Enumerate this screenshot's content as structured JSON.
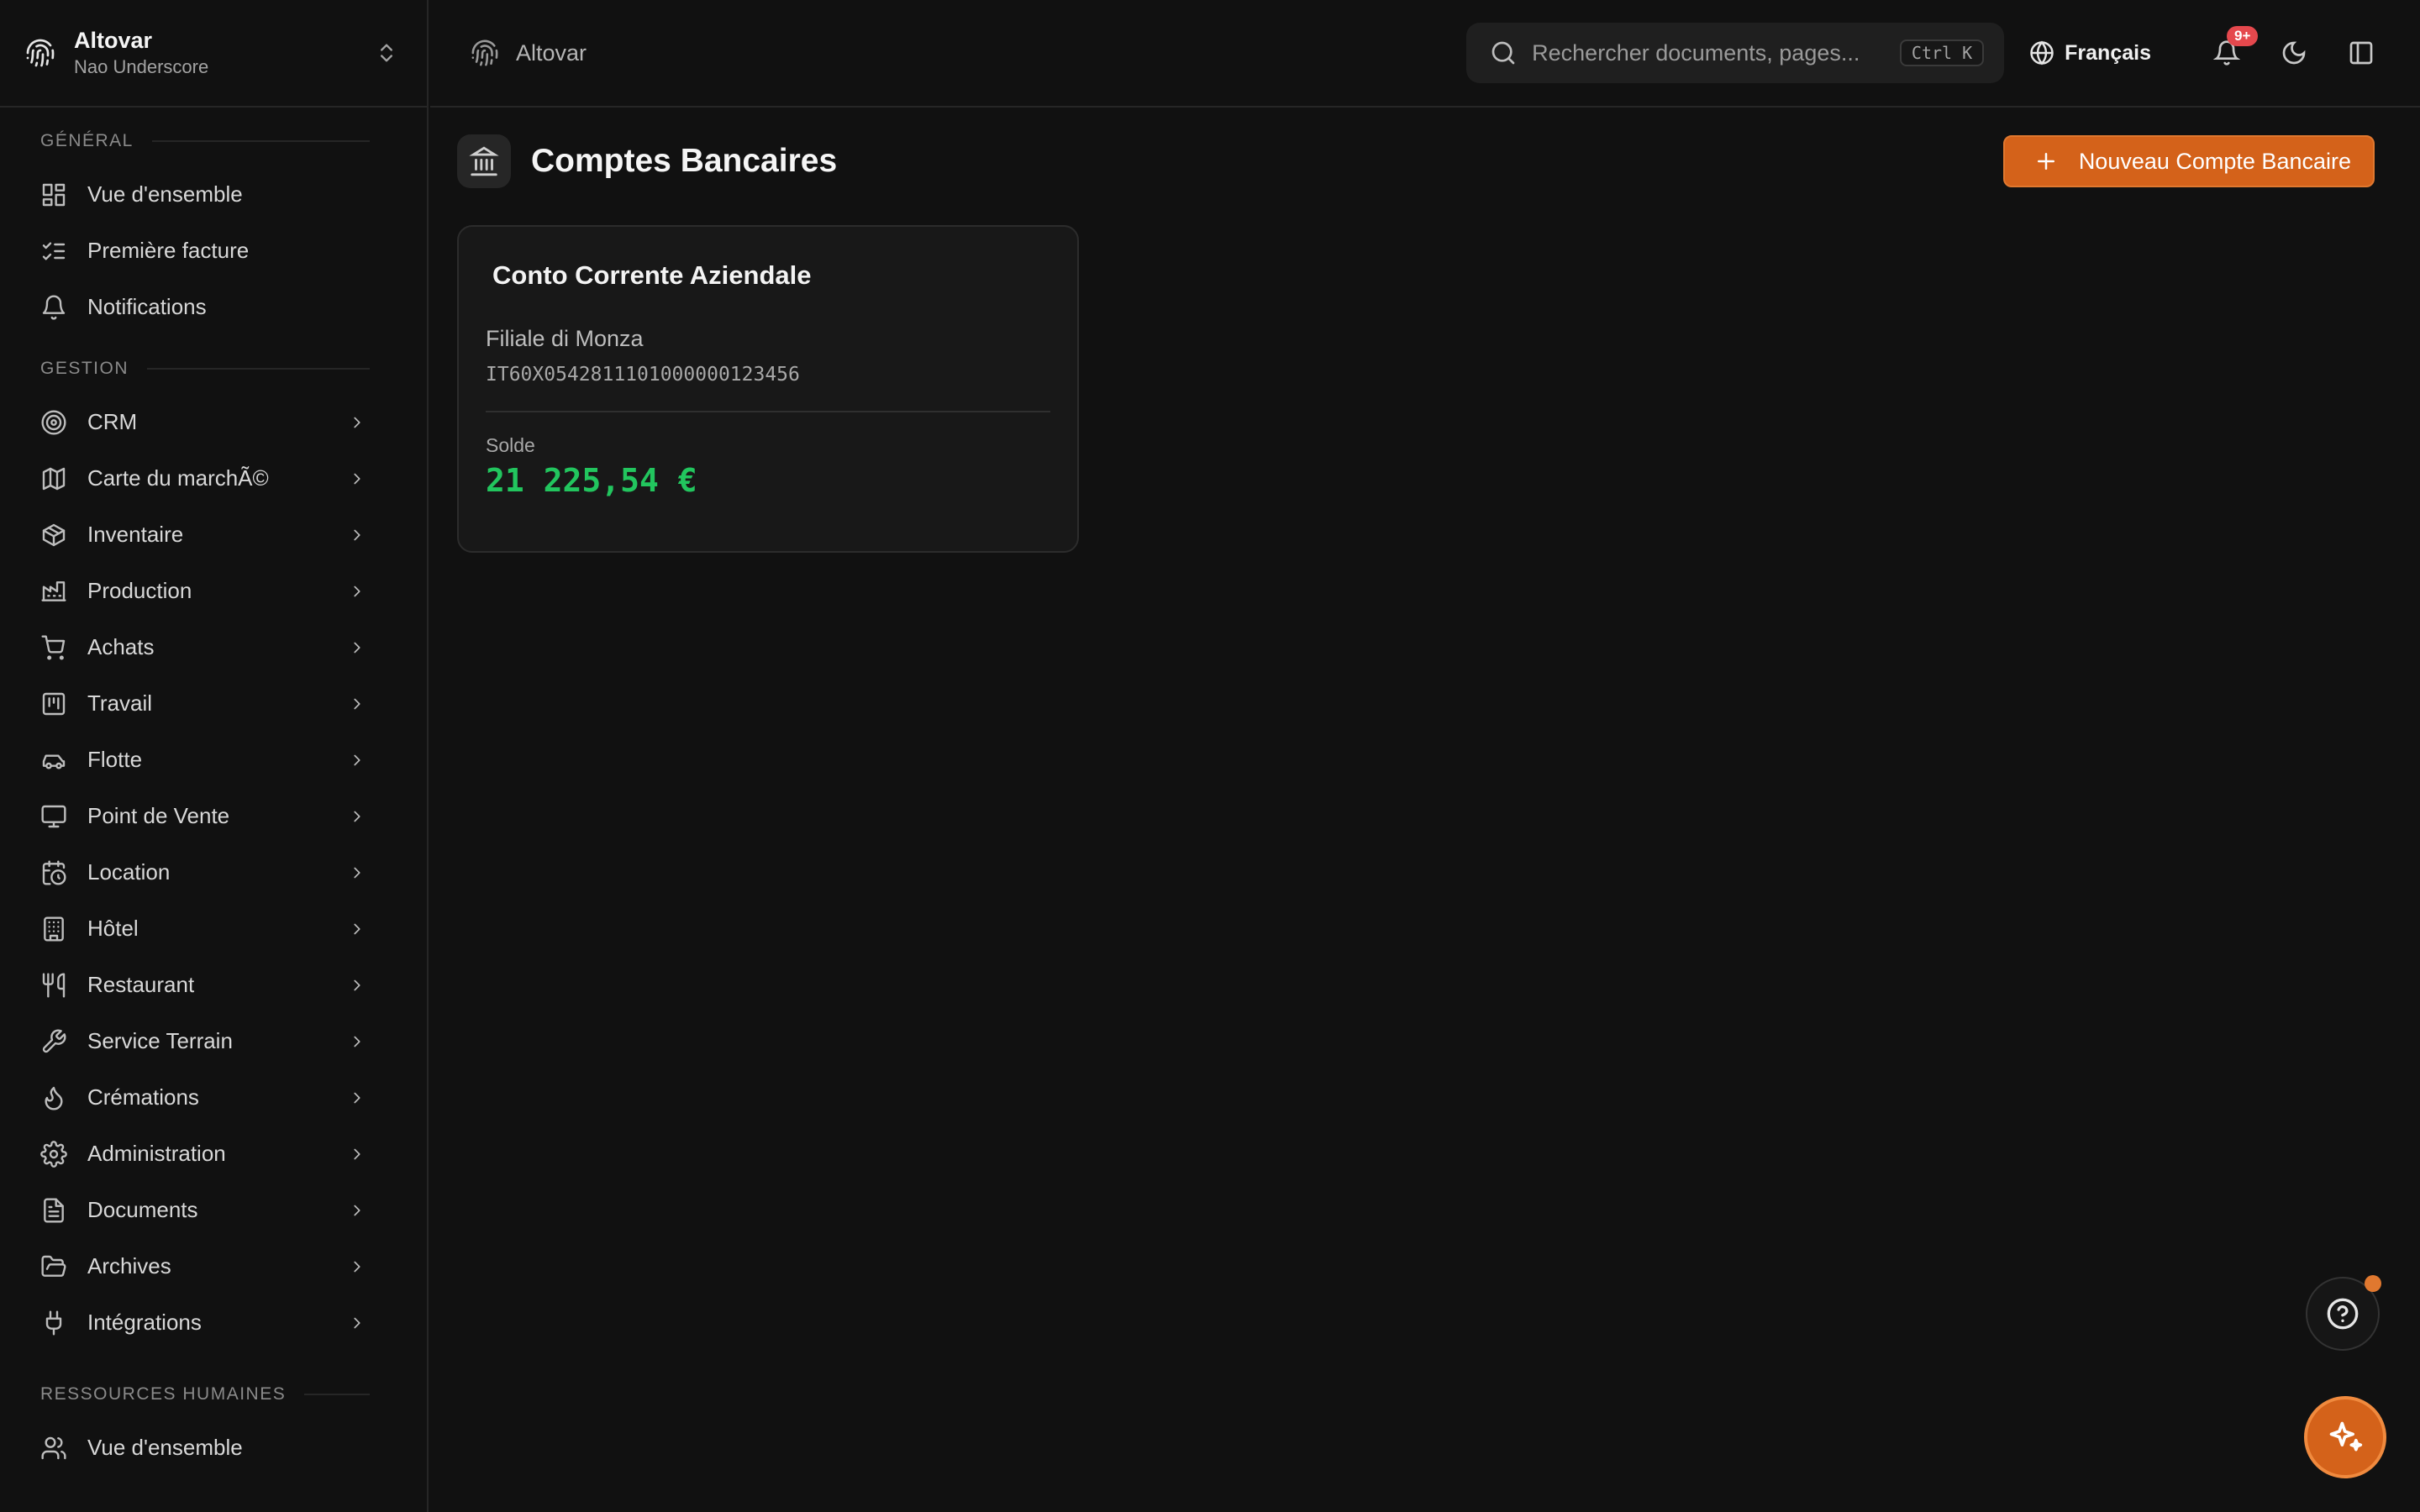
{
  "org": {
    "name": "Altovar",
    "subtitle": "Nao Underscore"
  },
  "topbar": {
    "breadcrumb": "Altovar",
    "search_placeholder": "Rechercher documents, pages...",
    "shortcut": "Ctrl K",
    "language": "Français",
    "notification_badge": "9+"
  },
  "sidebar": {
    "sections": [
      {
        "label": "GÉNÉRAL",
        "items": [
          {
            "label": "Vue d'ensemble",
            "icon": "dashboard-icon",
            "expandable": false
          },
          {
            "label": "Première facture",
            "icon": "checklist-icon",
            "expandable": false
          },
          {
            "label": "Notifications",
            "icon": "bell-icon",
            "expandable": false
          }
        ]
      },
      {
        "label": "GESTION",
        "items": [
          {
            "label": "CRM",
            "icon": "target-icon",
            "expandable": true
          },
          {
            "label": "Carte du marchÃ©",
            "icon": "map-icon",
            "expandable": true
          },
          {
            "label": "Inventaire",
            "icon": "package-icon",
            "expandable": true
          },
          {
            "label": "Production",
            "icon": "factory-icon",
            "expandable": true
          },
          {
            "label": "Achats",
            "icon": "cart-icon",
            "expandable": true
          },
          {
            "label": "Travail",
            "icon": "kanban-icon",
            "expandable": true
          },
          {
            "label": "Flotte",
            "icon": "car-icon",
            "expandable": true
          },
          {
            "label": "Point de Vente",
            "icon": "monitor-icon",
            "expandable": true
          },
          {
            "label": "Location",
            "icon": "calendar-clock-icon",
            "expandable": true
          },
          {
            "label": "Hôtel",
            "icon": "building-icon",
            "expandable": true
          },
          {
            "label": "Restaurant",
            "icon": "utensils-icon",
            "expandable": true
          },
          {
            "label": "Service Terrain",
            "icon": "wrench-icon",
            "expandable": true
          },
          {
            "label": "Crémations",
            "icon": "flame-icon",
            "expandable": true
          },
          {
            "label": "Administration",
            "icon": "gear-icon",
            "expandable": true
          },
          {
            "label": "Documents",
            "icon": "file-icon",
            "expandable": true
          },
          {
            "label": "Archives",
            "icon": "folder-open-icon",
            "expandable": true
          },
          {
            "label": "Intégrations",
            "icon": "plug-icon",
            "expandable": true
          }
        ]
      },
      {
        "label": "RESSOURCES HUMAINES",
        "items": [
          {
            "label": "Vue d'ensemble",
            "icon": "users-icon",
            "expandable": false
          }
        ]
      }
    ]
  },
  "page": {
    "title": "Comptes Bancaires",
    "new_button": "Nouveau Compte Bancaire"
  },
  "accounts": [
    {
      "name": "Conto Corrente Aziendale",
      "branch": "Filiale di Monza",
      "iban": "IT60X0542811101000000123456",
      "balance_label": "Solde",
      "balance": "21 225,54 €"
    }
  ],
  "colors": {
    "accent": "#d4621a",
    "balance": "#22c55e",
    "badge": "#e5484d"
  }
}
